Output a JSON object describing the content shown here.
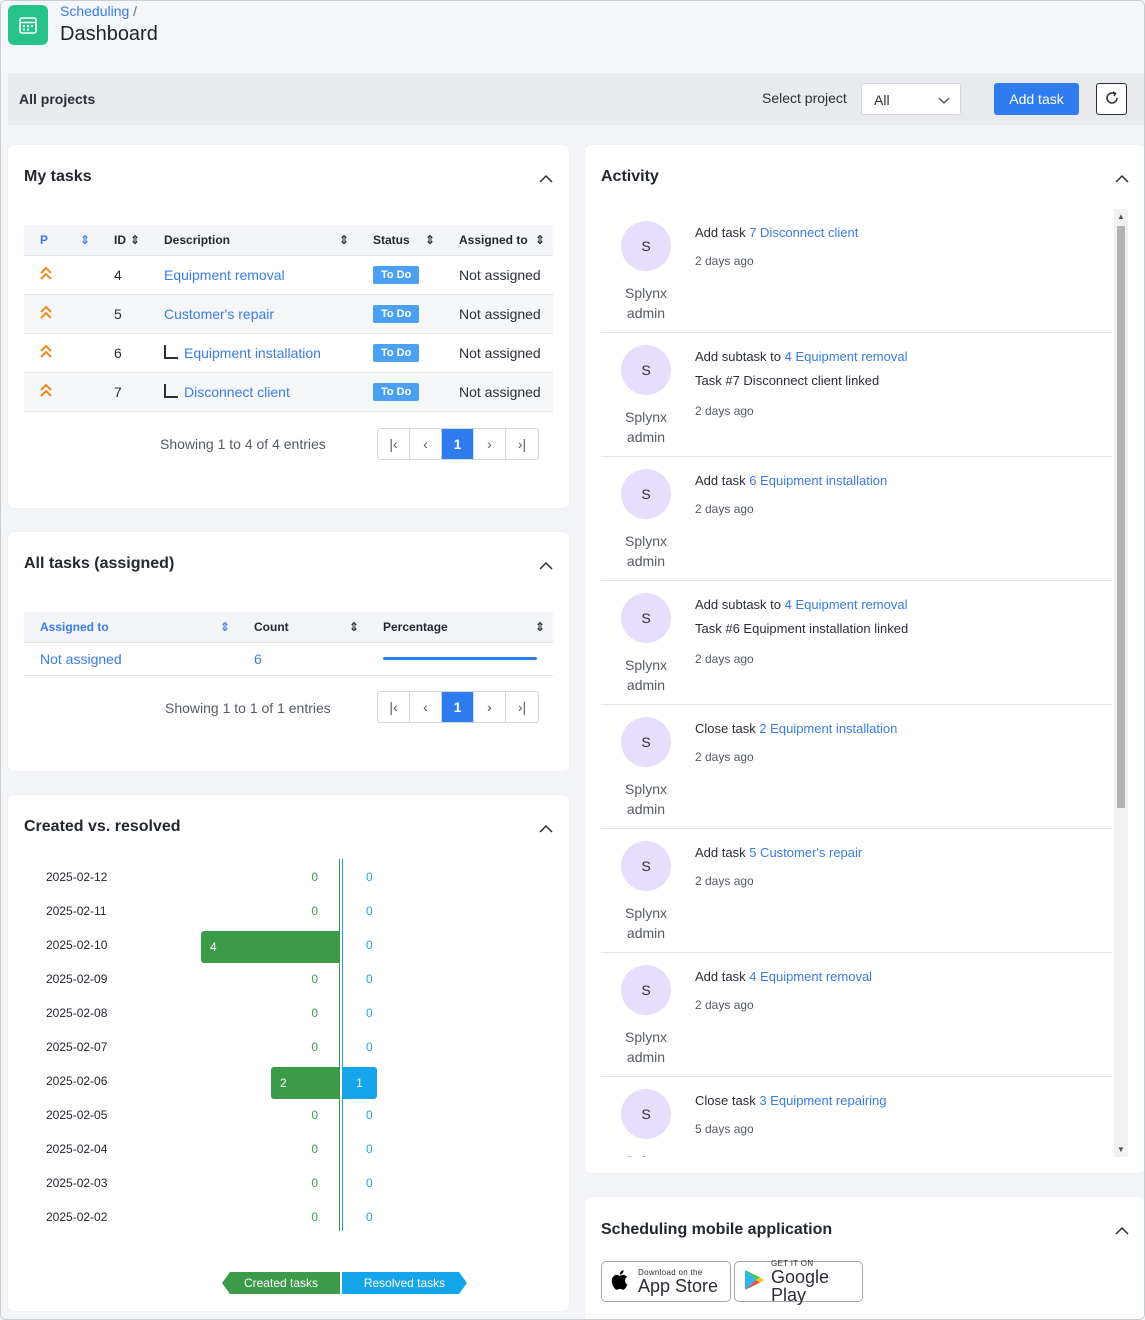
{
  "header": {
    "breadcrumb": "Scheduling",
    "breadcrumb_sep": "/",
    "title": "Dashboard"
  },
  "filter": {
    "label": "All projects",
    "select_label": "Select project",
    "select_value": "All",
    "add_task": "Add task"
  },
  "my_tasks": {
    "title": "My tasks",
    "columns": [
      "P",
      "ID",
      "Description",
      "Status",
      "Assigned to"
    ],
    "rows": [
      {
        "id": "4",
        "description": "Equipment removal",
        "status": "To Do",
        "assigned": "Not assigned",
        "subtask": false
      },
      {
        "id": "5",
        "description": "Customer's repair",
        "status": "To Do",
        "assigned": "Not assigned",
        "subtask": false
      },
      {
        "id": "6",
        "description": "Equipment installation",
        "status": "To Do",
        "assigned": "Not assigned",
        "subtask": true
      },
      {
        "id": "7",
        "description": "Disconnect client",
        "status": "To Do",
        "assigned": "Not assigned",
        "subtask": true
      }
    ],
    "showing": "Showing 1 to 4 of 4 entries",
    "page": "1"
  },
  "all_tasks": {
    "title": "All tasks (assigned)",
    "columns": [
      "Assigned to",
      "Count",
      "Percentage"
    ],
    "rows": [
      {
        "assigned": "Not assigned",
        "count": "6",
        "percentage": 1.0
      }
    ],
    "showing": "Showing 1 to 1 of 1 entries",
    "page": "1"
  },
  "created_resolved": {
    "title": "Created vs. resolved",
    "legend_created": "Created tasks",
    "legend_resolved": "Resolved tasks",
    "colors": {
      "created": "#3c9b48",
      "resolved": "#15a5ea"
    }
  },
  "chart_data": {
    "type": "bar",
    "categories": [
      "2025-02-12",
      "2025-02-11",
      "2025-02-10",
      "2025-02-09",
      "2025-02-08",
      "2025-02-07",
      "2025-02-06",
      "2025-02-05",
      "2025-02-04",
      "2025-02-03",
      "2025-02-02"
    ],
    "series": [
      {
        "name": "Created tasks",
        "values": [
          0,
          0,
          4,
          0,
          0,
          0,
          2,
          0,
          0,
          0,
          0
        ]
      },
      {
        "name": "Resolved tasks",
        "values": [
          0,
          0,
          0,
          0,
          0,
          0,
          1,
          0,
          0,
          0,
          0
        ]
      }
    ],
    "title": "Created vs. resolved",
    "legend": "bottom"
  },
  "activity": {
    "title": "Activity",
    "items": [
      {
        "action": "Add task",
        "link": "7 Disconnect client",
        "detail": "",
        "time": "2 days ago",
        "initial": "S",
        "user": "Splynx admin"
      },
      {
        "action": "Add subtask to",
        "link": "4 Equipment removal",
        "detail": "Task #7 Disconnect client linked",
        "time": "2 days ago",
        "initial": "S",
        "user": "Splynx admin"
      },
      {
        "action": "Add task",
        "link": "6 Equipment installation",
        "detail": "",
        "time": "2 days ago",
        "initial": "S",
        "user": "Splynx admin"
      },
      {
        "action": "Add subtask to",
        "link": "4 Equipment removal",
        "detail": "Task #6 Equipment installation linked",
        "time": "2 days ago",
        "initial": "S",
        "user": "Splynx admin"
      },
      {
        "action": "Close task",
        "link": "2 Equipment installation",
        "detail": "",
        "time": "2 days ago",
        "initial": "S",
        "user": "Splynx admin"
      },
      {
        "action": "Add task",
        "link": "5 Customer's repair",
        "detail": "",
        "time": "2 days ago",
        "initial": "S",
        "user": "Splynx admin"
      },
      {
        "action": "Add task",
        "link": "4 Equipment removal",
        "detail": "",
        "time": "2 days ago",
        "initial": "S",
        "user": "Splynx admin"
      },
      {
        "action": "Close task",
        "link": "3 Equipment repairing",
        "detail": "",
        "time": "5 days ago",
        "initial": "S",
        "user": "Splynx"
      }
    ]
  },
  "mobile": {
    "title": "Scheduling mobile application",
    "appstore_small": "Download on the",
    "appstore_big": "App Store",
    "play_small": "GET IT ON",
    "play_big": "Google Play"
  }
}
